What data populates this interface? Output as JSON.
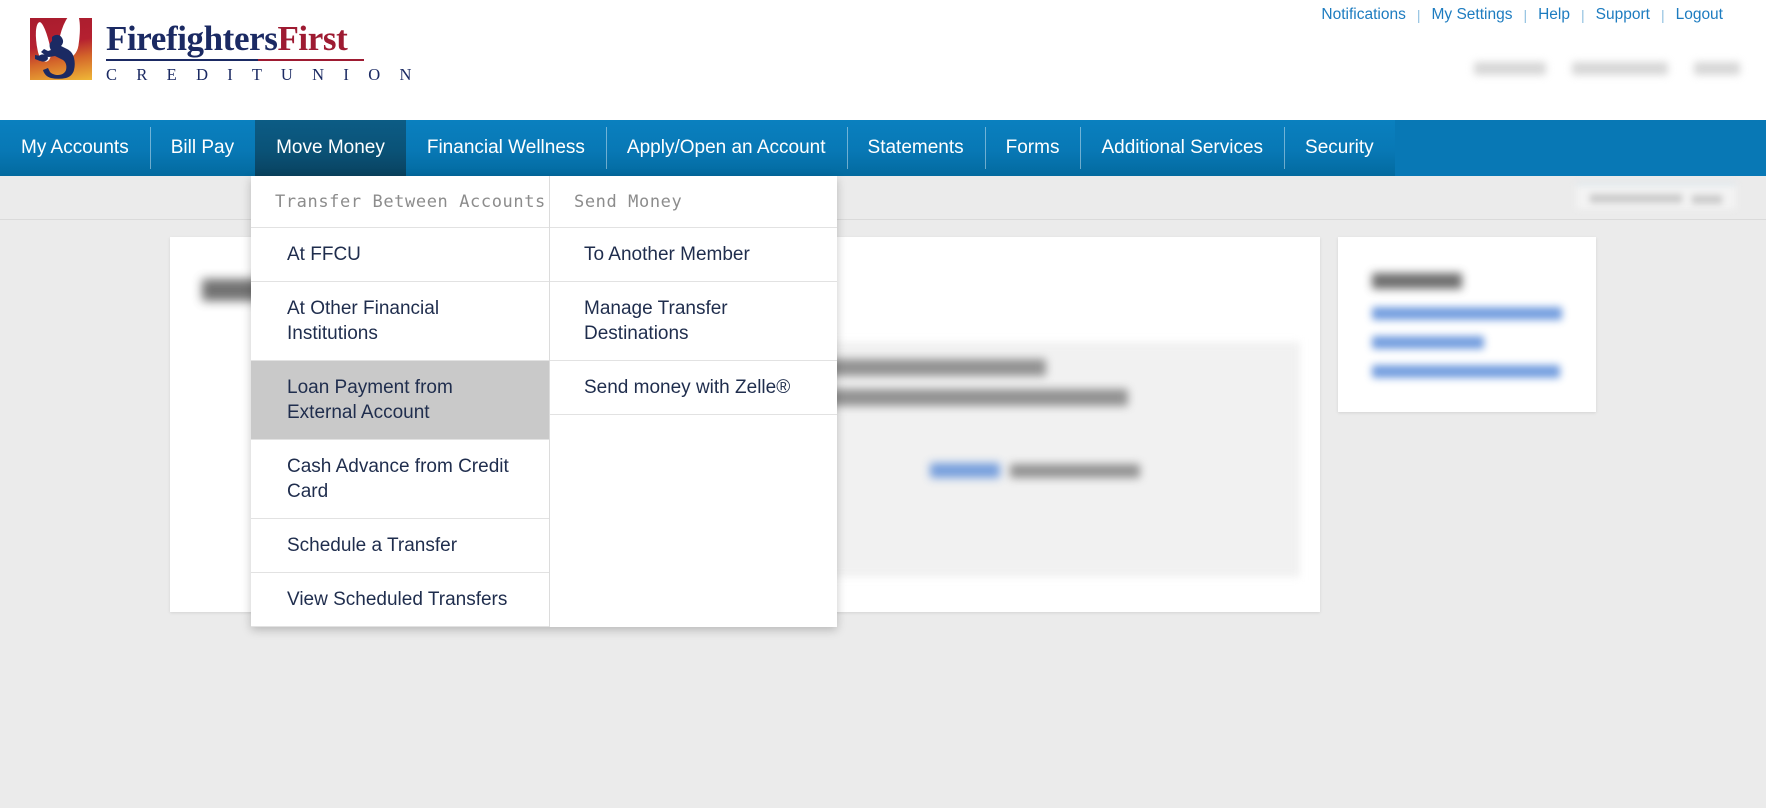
{
  "brand": {
    "name_part1": "Firefighters",
    "name_part2": "First",
    "subtitle": "C R E D I T   U N I O N",
    "logo_icon": "firefighter-flame-logo",
    "navy": "#1b2a63",
    "crimson": "#9e1b32",
    "nav_blue": "#0878b5",
    "nav_active_blue": "#0a5277",
    "link_blue": "#1d7cc0"
  },
  "utility_nav": {
    "separator": "|",
    "links": [
      {
        "label": "Notifications",
        "name": "notifications"
      },
      {
        "label": "My Settings",
        "name": "my-settings"
      },
      {
        "label": "Help",
        "name": "help"
      },
      {
        "label": "Support",
        "name": "support"
      },
      {
        "label": "Logout",
        "name": "logout"
      }
    ]
  },
  "main_nav": {
    "active": "Move Money",
    "items": [
      {
        "label": "My Accounts",
        "name": "my-accounts",
        "active": false
      },
      {
        "label": "Bill Pay",
        "name": "bill-pay",
        "active": false
      },
      {
        "label": "Move Money",
        "name": "move-money",
        "active": true
      },
      {
        "label": "Financial Wellness",
        "name": "financial-wellness",
        "active": false
      },
      {
        "label": "Apply/Open an Account",
        "name": "apply-open-an-account",
        "active": false
      },
      {
        "label": "Statements",
        "name": "statements",
        "active": false
      },
      {
        "label": "Forms",
        "name": "forms",
        "active": false
      },
      {
        "label": "Additional Services",
        "name": "additional-services",
        "active": false
      },
      {
        "label": "Security",
        "name": "security",
        "active": false
      }
    ]
  },
  "dropdown": {
    "open_for": "Move Money",
    "columns": [
      {
        "header": "Transfer Between Accounts",
        "items": [
          {
            "label": "At FFCU",
            "highlighted": false
          },
          {
            "label": "At Other Financial Institutions",
            "highlighted": false
          },
          {
            "label": "Loan Payment from External Account",
            "highlighted": true
          },
          {
            "label": "Cash Advance from Credit Card",
            "highlighted": false
          },
          {
            "label": "Schedule a Transfer",
            "highlighted": false
          },
          {
            "label": "View Scheduled Transfers",
            "highlighted": false
          }
        ]
      },
      {
        "header": "Send Money",
        "items": [
          {
            "label": "To Another Member",
            "highlighted": false
          },
          {
            "label": "Manage Transfer Destinations",
            "highlighted": false
          },
          {
            "label": "Send money with Zelle®",
            "highlighted": false
          }
        ]
      }
    ]
  },
  "page_content": {
    "note": "Main content area is visually blurred/obscured behind the open menu",
    "main_card_obscured": true,
    "side_card_obscured": true,
    "side_card_link_count": 3
  }
}
